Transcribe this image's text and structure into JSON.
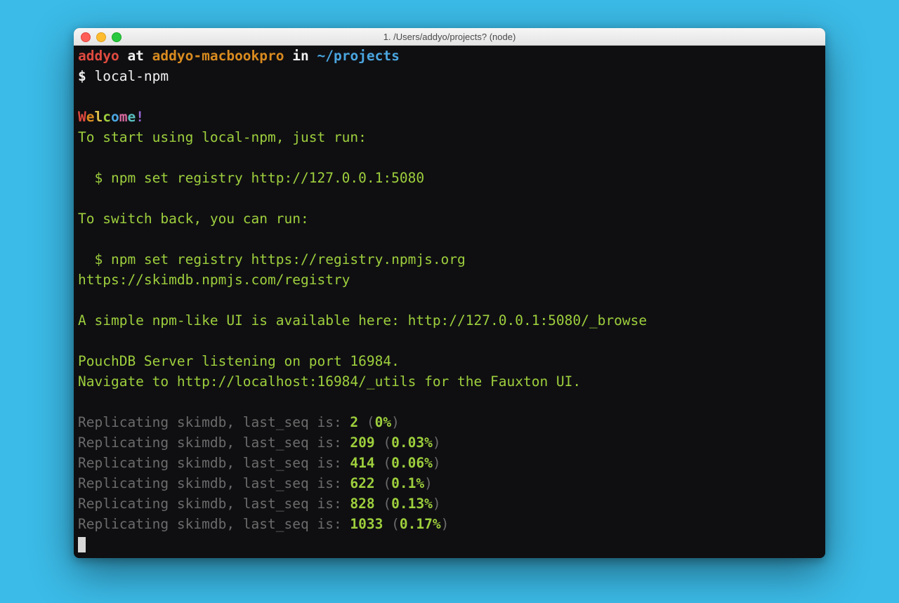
{
  "window": {
    "title": "1. /Users/addyo/projects? (node)"
  },
  "prompt": {
    "user": "addyo",
    "at": " at ",
    "host": "addyo-macbookpro",
    "in": " in ",
    "path": "~/projects",
    "symbol": "$ ",
    "command": "local-npm"
  },
  "welcome": {
    "letters": [
      "W",
      "e",
      "l",
      "c",
      "o",
      "m",
      "e",
      "!"
    ]
  },
  "lines": {
    "start_using": "To start using local-npm, just run:",
    "set_registry_local": "  $ npm set registry http://127.0.0.1:5080",
    "switch_back": "To switch back, you can run:",
    "set_registry_npmjs": "  $ npm set registry https://registry.npmjs.org",
    "skimdb_url": "https://skimdb.npmjs.com/registry",
    "browse_ui": "A simple npm-like UI is available here: http://127.0.0.1:5080/_browse",
    "pouchdb": "PouchDB Server listening on port 16984.",
    "fauxton": "Navigate to http://localhost:16984/_utils for the Fauxton UI."
  },
  "replication_prefix": "Replicating skimdb, last_seq is: ",
  "replication": [
    {
      "seq": "2",
      "pct": "0%"
    },
    {
      "seq": "209",
      "pct": "0.03%"
    },
    {
      "seq": "414",
      "pct": "0.06%"
    },
    {
      "seq": "622",
      "pct": "0.1%"
    },
    {
      "seq": "828",
      "pct": "0.13%"
    },
    {
      "seq": "1033",
      "pct": "0.17%"
    }
  ]
}
